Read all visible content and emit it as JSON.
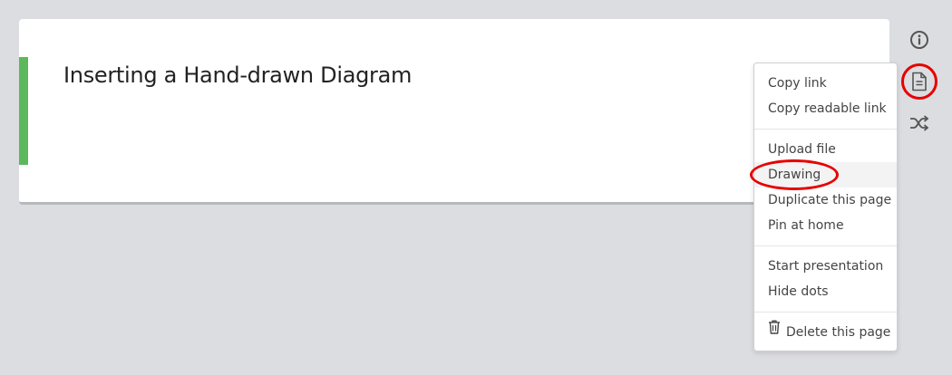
{
  "page": {
    "title": "Inserting a Hand-drawn Diagram",
    "accent_color": "#5cb85c"
  },
  "side_toolbar": {
    "icons": [
      "info-icon",
      "page-icon",
      "shuffle-icon"
    ],
    "highlighted": "page-icon"
  },
  "menu": {
    "groups": [
      [
        "Copy link",
        "Copy readable link"
      ],
      [
        "Upload file",
        "Drawing",
        "Duplicate this page",
        "Pin at home"
      ],
      [
        "Start presentation",
        "Hide dots"
      ],
      [
        "Delete this page"
      ]
    ],
    "items": {
      "copy_link": "Copy link",
      "copy_readable_link": "Copy readable link",
      "upload_file": "Upload file",
      "drawing": "Drawing",
      "duplicate_page": "Duplicate this page",
      "pin_home": "Pin at home",
      "start_presentation": "Start presentation",
      "hide_dots": "Hide dots",
      "delete_page": "Delete this page"
    },
    "hovered": "Drawing",
    "annotation_color": "#e60000"
  }
}
